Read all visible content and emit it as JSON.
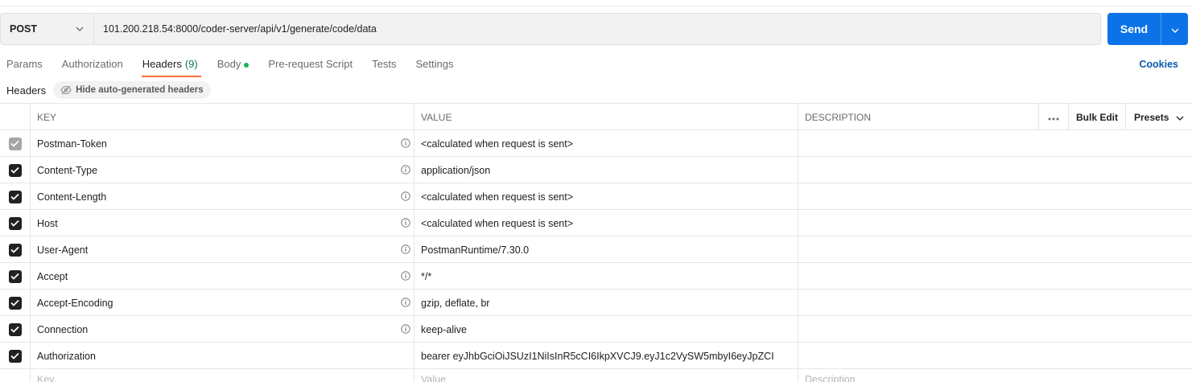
{
  "request": {
    "method": "POST",
    "url": "101.200.218.54:8000/coder-server/api/v1/generate/code/data",
    "send_label": "Send"
  },
  "tabs": [
    {
      "label": "Params"
    },
    {
      "label": "Authorization"
    },
    {
      "label": "Headers",
      "count": "(9)",
      "active": true
    },
    {
      "label": "Body",
      "dot": true
    },
    {
      "label": "Pre-request Script"
    },
    {
      "label": "Tests"
    },
    {
      "label": "Settings"
    }
  ],
  "cookies_label": "Cookies",
  "subheader": {
    "title": "Headers",
    "hide_button": "Hide auto-generated headers"
  },
  "table": {
    "columns": {
      "key": "KEY",
      "value": "VALUE",
      "description": "DESCRIPTION"
    },
    "bulk_edit": "Bulk Edit",
    "presets": "Presets",
    "rows": [
      {
        "key": "Postman-Token",
        "value": "<calculated when request is sent>",
        "disabled": true,
        "info": true
      },
      {
        "key": "Content-Type",
        "value": "application/json",
        "info": true
      },
      {
        "key": "Content-Length",
        "value": "<calculated when request is sent>",
        "info": true
      },
      {
        "key": "Host",
        "value": "<calculated when request is sent>",
        "info": true
      },
      {
        "key": "User-Agent",
        "value": "PostmanRuntime/7.30.0",
        "info": true
      },
      {
        "key": "Accept",
        "value": "*/*",
        "info": true
      },
      {
        "key": "Accept-Encoding",
        "value": "gzip, deflate, br",
        "info": true
      },
      {
        "key": "Connection",
        "value": "keep-alive",
        "info": true
      },
      {
        "key": "Authorization",
        "value": "bearer eyJhbGciOiJSUzI1NiIsInR5cCI6IkpXVCJ9.eyJ1c2VySW5mbyI6eyJpZCI",
        "info": false
      }
    ],
    "placeholders": {
      "key": "Key",
      "value": "Value",
      "description": "Description"
    }
  },
  "colors": {
    "send": "#0b72e7",
    "active_tab_underline": "#ff6c37",
    "count": "#0f7b3e",
    "body_dot": "#0cbb52",
    "link": "#0b5cad"
  }
}
